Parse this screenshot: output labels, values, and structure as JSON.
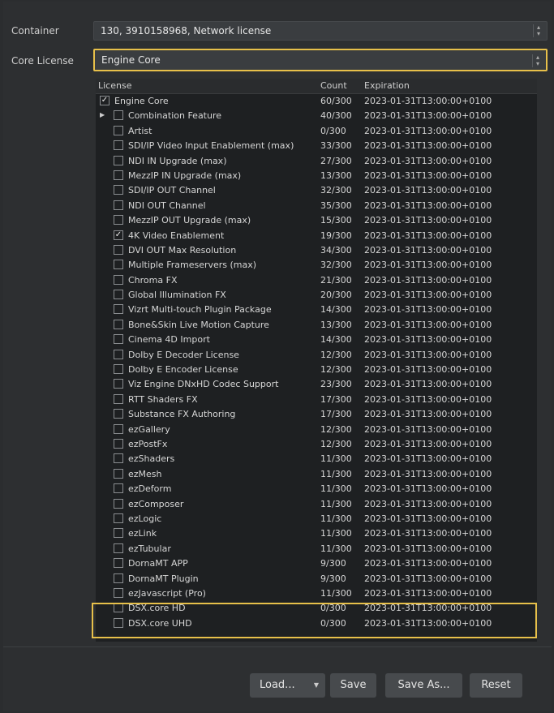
{
  "container": {
    "label": "Container",
    "value": "130, 3910158968, Network license"
  },
  "core_license": {
    "label": "Core License",
    "value": "Engine Core"
  },
  "table": {
    "headers": {
      "license": "License",
      "count": "Count",
      "expiration": "Expiration"
    },
    "rows": [
      {
        "name": "Engine Core",
        "count": "60/300",
        "exp": "2023-01-31T13:00:00+0100",
        "checked": true,
        "level": 0,
        "expander": false
      },
      {
        "name": "Combination Feature",
        "count": "40/300",
        "exp": "2023-01-31T13:00:00+0100",
        "checked": false,
        "level": 1,
        "expander": true
      },
      {
        "name": "Artist",
        "count": "0/300",
        "exp": "2023-01-31T13:00:00+0100",
        "checked": false,
        "level": 1,
        "expander": false
      },
      {
        "name": "SDI/IP Video Input Enablement (max)",
        "count": "33/300",
        "exp": "2023-01-31T13:00:00+0100",
        "checked": false,
        "level": 1,
        "expander": false
      },
      {
        "name": "NDI IN Upgrade (max)",
        "count": "27/300",
        "exp": "2023-01-31T13:00:00+0100",
        "checked": false,
        "level": 1,
        "expander": false
      },
      {
        "name": "MezzIP IN Upgrade (max)",
        "count": "13/300",
        "exp": "2023-01-31T13:00:00+0100",
        "checked": false,
        "level": 1,
        "expander": false
      },
      {
        "name": "SDI/IP OUT Channel",
        "count": "32/300",
        "exp": "2023-01-31T13:00:00+0100",
        "checked": false,
        "level": 1,
        "expander": false
      },
      {
        "name": "NDI OUT Channel",
        "count": "35/300",
        "exp": "2023-01-31T13:00:00+0100",
        "checked": false,
        "level": 1,
        "expander": false
      },
      {
        "name": "MezzIP OUT Upgrade (max)",
        "count": "15/300",
        "exp": "2023-01-31T13:00:00+0100",
        "checked": false,
        "level": 1,
        "expander": false
      },
      {
        "name": "4K Video Enablement",
        "count": "19/300",
        "exp": "2023-01-31T13:00:00+0100",
        "checked": true,
        "level": 1,
        "expander": false
      },
      {
        "name": "DVI OUT Max Resolution",
        "count": "34/300",
        "exp": "2023-01-31T13:00:00+0100",
        "checked": false,
        "level": 1,
        "expander": false
      },
      {
        "name": "Multiple Frameservers (max)",
        "count": "32/300",
        "exp": "2023-01-31T13:00:00+0100",
        "checked": false,
        "level": 1,
        "expander": false
      },
      {
        "name": "Chroma FX",
        "count": "21/300",
        "exp": "2023-01-31T13:00:00+0100",
        "checked": false,
        "level": 1,
        "expander": false
      },
      {
        "name": "Global Illumination FX",
        "count": "20/300",
        "exp": "2023-01-31T13:00:00+0100",
        "checked": false,
        "level": 1,
        "expander": false
      },
      {
        "name": "Vizrt Multi-touch Plugin Package",
        "count": "14/300",
        "exp": "2023-01-31T13:00:00+0100",
        "checked": false,
        "level": 1,
        "expander": false
      },
      {
        "name": "Bone&Skin Live Motion Capture",
        "count": "13/300",
        "exp": "2023-01-31T13:00:00+0100",
        "checked": false,
        "level": 1,
        "expander": false
      },
      {
        "name": "Cinema 4D Import",
        "count": "14/300",
        "exp": "2023-01-31T13:00:00+0100",
        "checked": false,
        "level": 1,
        "expander": false
      },
      {
        "name": "Dolby E Decoder License",
        "count": "12/300",
        "exp": "2023-01-31T13:00:00+0100",
        "checked": false,
        "level": 1,
        "expander": false
      },
      {
        "name": "Dolby E Encoder License",
        "count": "12/300",
        "exp": "2023-01-31T13:00:00+0100",
        "checked": false,
        "level": 1,
        "expander": false
      },
      {
        "name": "Viz Engine DNxHD Codec Support",
        "count": "23/300",
        "exp": "2023-01-31T13:00:00+0100",
        "checked": false,
        "level": 1,
        "expander": false
      },
      {
        "name": "RTT Shaders FX",
        "count": "17/300",
        "exp": "2023-01-31T13:00:00+0100",
        "checked": false,
        "level": 1,
        "expander": false
      },
      {
        "name": "Substance FX Authoring",
        "count": "17/300",
        "exp": "2023-01-31T13:00:00+0100",
        "checked": false,
        "level": 1,
        "expander": false
      },
      {
        "name": "ezGallery",
        "count": "12/300",
        "exp": "2023-01-31T13:00:00+0100",
        "checked": false,
        "level": 1,
        "expander": false
      },
      {
        "name": "ezPostFx",
        "count": "12/300",
        "exp": "2023-01-31T13:00:00+0100",
        "checked": false,
        "level": 1,
        "expander": false
      },
      {
        "name": "ezShaders",
        "count": "11/300",
        "exp": "2023-01-31T13:00:00+0100",
        "checked": false,
        "level": 1,
        "expander": false
      },
      {
        "name": "ezMesh",
        "count": "11/300",
        "exp": "2023-01-31T13:00:00+0100",
        "checked": false,
        "level": 1,
        "expander": false
      },
      {
        "name": "ezDeform",
        "count": "11/300",
        "exp": "2023-01-31T13:00:00+0100",
        "checked": false,
        "level": 1,
        "expander": false
      },
      {
        "name": "ezComposer",
        "count": "11/300",
        "exp": "2023-01-31T13:00:00+0100",
        "checked": false,
        "level": 1,
        "expander": false
      },
      {
        "name": "ezLogic",
        "count": "11/300",
        "exp": "2023-01-31T13:00:00+0100",
        "checked": false,
        "level": 1,
        "expander": false
      },
      {
        "name": "ezLink",
        "count": "11/300",
        "exp": "2023-01-31T13:00:00+0100",
        "checked": false,
        "level": 1,
        "expander": false
      },
      {
        "name": "ezTubular",
        "count": "11/300",
        "exp": "2023-01-31T13:00:00+0100",
        "checked": false,
        "level": 1,
        "expander": false
      },
      {
        "name": "DornaMT APP",
        "count": "9/300",
        "exp": "2023-01-31T13:00:00+0100",
        "checked": false,
        "level": 1,
        "expander": false
      },
      {
        "name": "DornaMT Plugin",
        "count": "9/300",
        "exp": "2023-01-31T13:00:00+0100",
        "checked": false,
        "level": 1,
        "expander": false
      },
      {
        "name": "ezJavascript (Pro)",
        "count": "11/300",
        "exp": "2023-01-31T13:00:00+0100",
        "checked": false,
        "level": 1,
        "expander": false
      },
      {
        "name": "DSX.core HD",
        "count": "0/300",
        "exp": "2023-01-31T13:00:00+0100",
        "checked": false,
        "level": 1,
        "expander": false
      },
      {
        "name": "DSX.core UHD",
        "count": "0/300",
        "exp": "2023-01-31T13:00:00+0100",
        "checked": false,
        "level": 1,
        "expander": false
      }
    ]
  },
  "buttons": {
    "load": "Load...",
    "save": "Save",
    "save_as": "Save As...",
    "reset": "Reset"
  },
  "colors": {
    "highlight": "#e7c04a",
    "background": "#2d2f31",
    "table_bg": "#1e2022"
  }
}
